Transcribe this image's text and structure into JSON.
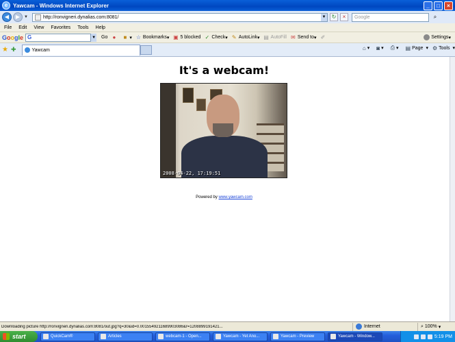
{
  "window": {
    "title": "Yawcam - Windows Internet Explorer"
  },
  "address_bar": {
    "url": "http://ronvigneri.dynalias.com:8081/",
    "search_placeholder": "Google"
  },
  "menu": [
    "File",
    "Edit",
    "View",
    "Favorites",
    "Tools",
    "Help"
  ],
  "google_toolbar": {
    "logo": [
      "G",
      "o",
      "o",
      "g",
      "l",
      "e"
    ],
    "go_label": "Go",
    "items": [
      "Bookmarks",
      "5 blocked",
      "Check",
      "AutoLink",
      "AutoFill",
      "Send to"
    ],
    "settings_label": "Settings"
  },
  "tab": {
    "label": "Yawcam"
  },
  "command_bar": {
    "page_label": "Page",
    "tools_label": "Tools"
  },
  "page": {
    "heading": "It's a webcam!",
    "timestamp": "2008-04-22, 17:19:51",
    "powered_by": "Powered by",
    "powered_link": "www.yawcam.com"
  },
  "status_bar": {
    "message": "Downloading picture http://ronvigneri.dynalias.com:8081/out.jpg?q=30&id=0.0015549211689903086&r=1208899191421...",
    "zone": "Internet",
    "zoom": "100%"
  },
  "taskbar": {
    "start_label": "start",
    "tasks": [
      "QuickCam®",
      "Articles",
      "webcam-1 - Open...",
      "Yawcam - Yet Ano...",
      "Yawcam - Preview",
      "Yawcam - Window..."
    ],
    "clock": "5:19 PM"
  }
}
